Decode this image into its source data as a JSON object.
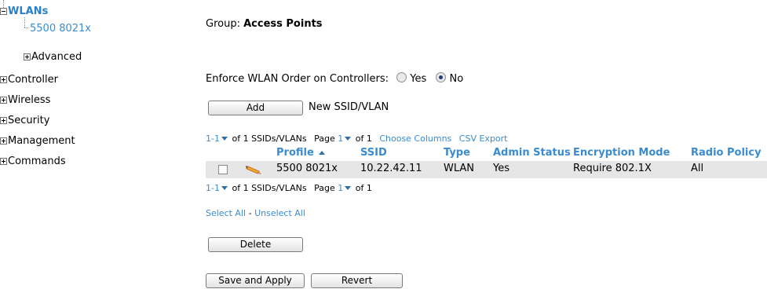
{
  "nav": {
    "wlans": "WLANs",
    "wlan_item": "5500 8021x",
    "items": [
      "Advanced",
      "Controller",
      "Wireless",
      "Security",
      "Management",
      "Commands"
    ]
  },
  "group": {
    "label": "Group:",
    "value": "Access Points"
  },
  "enforce": {
    "label": "Enforce WLAN Order on Controllers:",
    "yes": "Yes",
    "no": "No",
    "selected": "No"
  },
  "add": {
    "button": "Add",
    "label": "New SSID/VLAN"
  },
  "pager_top": {
    "range": "1-1",
    "of_text": "of 1 SSIDs/VLANs",
    "page_label": "Page",
    "page": "1",
    "of_pages": "of 1",
    "choose_columns": "Choose Columns",
    "csv_export": "CSV Export"
  },
  "table": {
    "headers": [
      "Profile",
      "SSID",
      "Type",
      "Admin Status",
      "Encryption Mode",
      "Radio Policy"
    ],
    "sorted_by": "Profile",
    "rows": [
      {
        "profile": "5500 8021x",
        "ssid": "10.22.42.11",
        "type": "WLAN",
        "admin_status": "Yes",
        "encryption_mode": "Require 802.1X",
        "radio_policy": "All"
      }
    ]
  },
  "pager_bottom": {
    "range": "1-1",
    "of_text": "of 1 SSIDs/VLANs",
    "page_label": "Page",
    "page": "1",
    "of_pages": "of 1"
  },
  "select": {
    "select_all": "Select All",
    "separator": "-",
    "unselect_all": "Unselect All"
  },
  "buttons": {
    "delete": "Delete",
    "save_apply": "Save and Apply",
    "revert": "Revert"
  },
  "colors": {
    "link": "#3a8bd0",
    "row_bg": "#e6e6e6"
  }
}
